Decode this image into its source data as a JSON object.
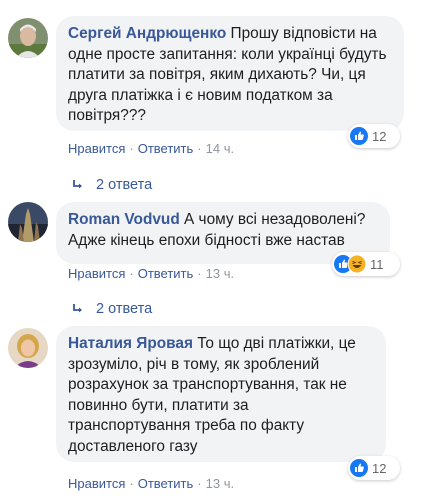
{
  "comments": [
    {
      "author": "Сергей Андрющенко",
      "text": "Прошу відповісти на одне просте запитання: коли українці будуть платити за повітря, яким дихають? Чи, ця друга платіжка і є новим податком за повітря???",
      "reaction_count": "12",
      "like_label": "Нравится",
      "reply_label": "Ответить",
      "time": "14 ч.",
      "replies_label": "2 ответа"
    },
    {
      "author": "Roman Vodvud",
      "text": "А чому всі незадоволені? Адже кінець епохи бідності вже настав",
      "reaction_count": "11",
      "like_label": "Нравится",
      "reply_label": "Ответить",
      "time": "13 ч.",
      "replies_label": "2 ответа"
    },
    {
      "author": "Наталия Яровая",
      "text": "То що дві платіжки, це зрозуміло, річ в тому, як зроблений розрахунок за транспортування, так не повинно бути, платити за транспортування треба по факту доставленого газу",
      "reaction_count": "12",
      "like_label": "Нравится",
      "reply_label": "Ответить",
      "time": "13 ч."
    }
  ],
  "separator": "·",
  "colors": {
    "link": "#385898",
    "bubble": "#f2f3f5",
    "meta": "#90949c",
    "like_blue": "#1877f2",
    "haha_yellow": "#f7b125"
  },
  "icons": {
    "like": "like-icon",
    "haha": "haha-icon",
    "reply_arrow": "reply-arrow-icon"
  }
}
